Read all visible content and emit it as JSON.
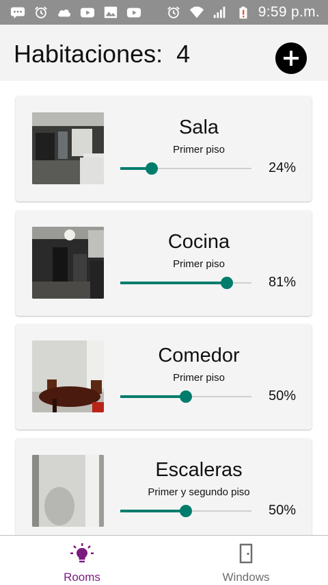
{
  "status_bar": {
    "time": "9:59 p.m.",
    "left_icons": [
      "message-icon",
      "alarm-icon",
      "cloud-icon",
      "youtube-icon",
      "gallery-icon",
      "youtube-icon"
    ],
    "right_icons": [
      "alarm-icon",
      "wifi-icon",
      "signal-icon",
      "battery-alert-icon"
    ]
  },
  "header": {
    "title": "Habitaciones:",
    "count": "4",
    "add_icon": "plus-icon"
  },
  "rooms": [
    {
      "name": "Sala",
      "floor": "Primer piso",
      "level": 24,
      "level_label": "24%",
      "photo_icon": "living-room-photo"
    },
    {
      "name": "Cocina",
      "floor": "Primer piso",
      "level": 81,
      "level_label": "81%",
      "photo_icon": "kitchen-photo"
    },
    {
      "name": "Comedor",
      "floor": "Primer piso",
      "level": 50,
      "level_label": "50%",
      "photo_icon": "dining-room-photo"
    },
    {
      "name": "Escaleras",
      "floor": "Primer y segundo piso",
      "level": 50,
      "level_label": "50%",
      "photo_icon": "stairs-photo"
    }
  ],
  "bottom_nav": {
    "items": [
      {
        "label": "Rooms",
        "icon": "lightbulb-icon",
        "active": true
      },
      {
        "label": "Windows",
        "icon": "door-icon",
        "active": false
      }
    ]
  },
  "colors": {
    "accent": "#007c6c",
    "active_nav": "#7b1a7f",
    "inactive_nav": "#6e6e6e",
    "status_bar": "#8f8f8f",
    "header_bg": "#f3f3f3",
    "card_bg": "#f4f4f4"
  }
}
